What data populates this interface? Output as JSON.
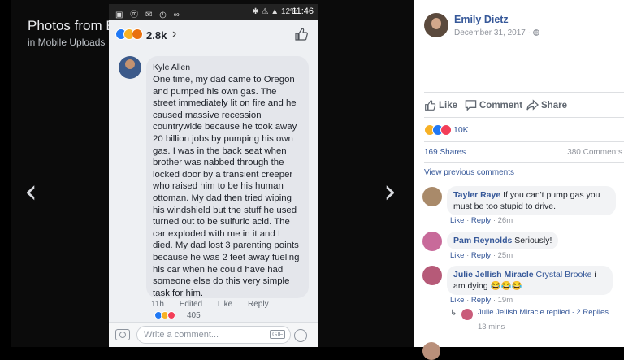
{
  "theater": {
    "title": "Photos from Emily Dietz's post",
    "subtitle": "in Mobile Uploads",
    "prev_arrow": "‹",
    "next_arrow": "›"
  },
  "phone": {
    "status": {
      "left_icons": "▣ ⓜ ✉ ◴ ∞",
      "right_text": "✱ ⚠ ▲ 12%",
      "time": "11:46"
    },
    "reactions": {
      "count": "2.8k",
      "chevron": "›"
    },
    "comment": {
      "author": "Kyle Allen",
      "text": "One time, my dad came to Oregon and pumped his own gas. The street immediately lit on fire and he caused massive recession countrywide because he took away 20 billion jobs by pumping his own gas. I was in the back seat when brother was nabbed through the locked door by a transient creeper who raised him to be his human ottoman. My dad then tried wiping his windshield but the stuff he used turned out to be sulfuric acid. The car exploded with me in it and I died. My dad lost 3 parenting points because he was 2 feet away fueling his car when he could have had someone else do this very simple task for him.",
      "time": "11h",
      "edited": "Edited",
      "like": "Like",
      "reply": "Reply",
      "reaction_count": "405"
    },
    "composer": {
      "placeholder": "Write a comment...",
      "gif_label": "GIF"
    }
  },
  "panel": {
    "poster_name": "Emily Dietz",
    "post_date": "December 31, 2017 · ",
    "actions": {
      "like": "Like",
      "comment": "Comment",
      "share": "Share"
    },
    "reactions_count": "10K",
    "shares": "169 Shares",
    "comments_count": "380 Comments",
    "view_previous": "View previous comments",
    "comments": [
      {
        "author": "Tayler Raye",
        "text": " If you can't pump gas you must be too stupid to drive.",
        "like": "Like",
        "reply": "Reply",
        "time": "26m",
        "sep": " · "
      },
      {
        "author": "Pam Reynolds",
        "text": " Seriously!",
        "like": "Like",
        "reply": "Reply",
        "time": "25m",
        "sep": " · "
      },
      {
        "author": "Julie Jellish Miracle",
        "mention": " Crystal Brooke",
        "text": " i am dying 😂😂😂",
        "like": "Like",
        "reply": "Reply",
        "time": "19m",
        "sep": " · "
      }
    ],
    "replies": {
      "text": "Julie Jellish Miracle replied · 2 Replies",
      "time": "13 mins"
    }
  },
  "colors": {
    "facebook_blue": "#365899",
    "like_blue": "#2078f4",
    "love_red": "#f33e58",
    "haha_yellow": "#f7b125"
  }
}
